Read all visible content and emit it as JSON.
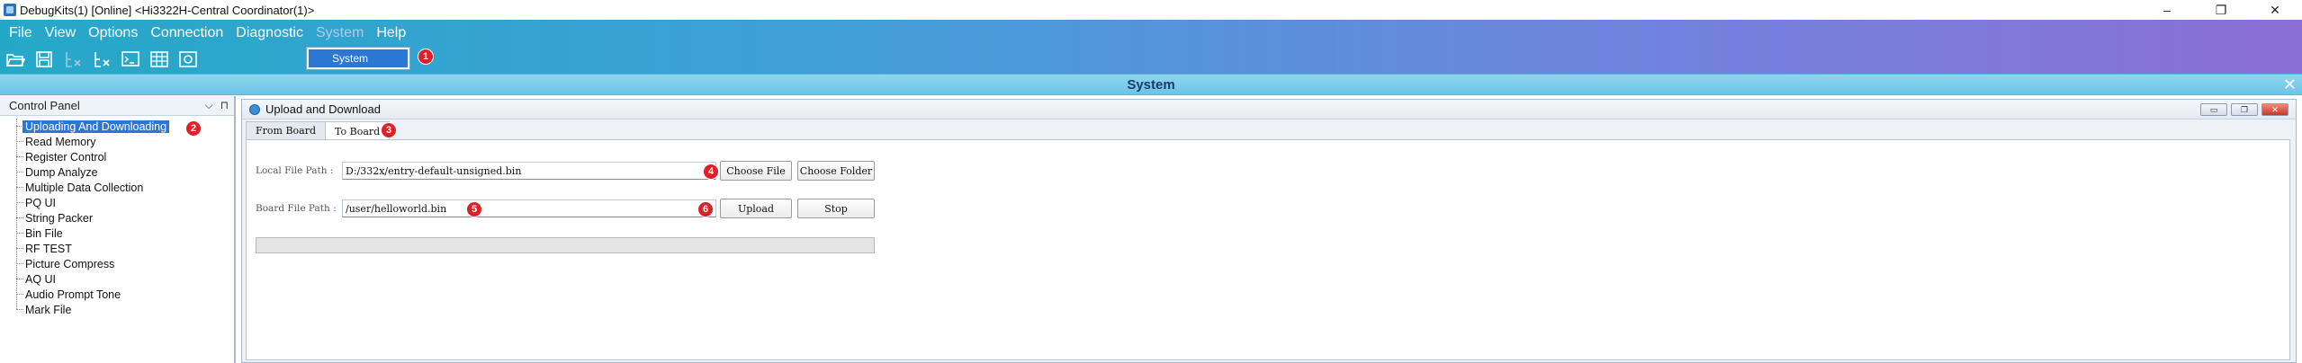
{
  "window": {
    "title": "DebugKits(1) [Online] <Hi3322H-Central Coordinator(1)>",
    "controls": [
      "–",
      "❐",
      "✕"
    ]
  },
  "menu": {
    "items": [
      "File",
      "View",
      "Options",
      "Connection",
      "Diagnostic",
      "System",
      "Help"
    ],
    "active_index": 5,
    "dropdown": {
      "items": [
        "System"
      ]
    }
  },
  "toolbar": {
    "icons": [
      "folder-open-icon",
      "save-icon",
      "disabled-tool-icon",
      "tool-icon",
      "terminal-icon",
      "table-icon",
      "settings-icon"
    ]
  },
  "badges": [
    "1",
    "2",
    "3",
    "4",
    "5",
    "6"
  ],
  "system_bar": {
    "title": "System",
    "close": "✕"
  },
  "control_panel": {
    "title": "Control Panel",
    "header_icons": [
      "⌵",
      "⊓"
    ],
    "selected_index": 0,
    "items": [
      "Uploading And Downloading",
      "Read Memory",
      "Register Control",
      "Dump Analyze",
      "Multiple Data Collection",
      "PQ UI",
      "String Packer",
      "Bin File",
      "RF TEST",
      "Picture Compress",
      "AQ UI",
      "Audio Prompt Tone",
      "Mark File"
    ]
  },
  "main_panel": {
    "title": "Upload and Download",
    "controls": [
      "▭",
      "❐",
      "✕"
    ],
    "tabs": [
      "From Board",
      "To Board"
    ],
    "active_tab": 1,
    "local_file": {
      "label": "Local File Path :",
      "value": "D:/332x/entry-default-unsigned.bin",
      "choose_file": "Choose File",
      "choose_folder": "Choose Folder"
    },
    "board_file": {
      "label": "Board File Path :",
      "value": "/user/helloworld.bin",
      "upload": "Upload",
      "stop": "Stop"
    },
    "progress": 0
  }
}
